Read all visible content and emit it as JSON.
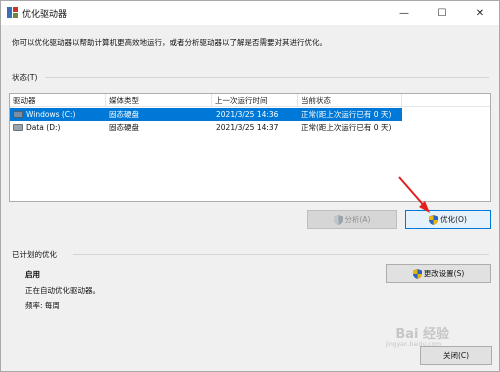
{
  "window": {
    "title": "优化驱动器",
    "controls": {
      "minimize": "—",
      "maximize": "☐",
      "close": "✕"
    }
  },
  "description": "你可以优化驱动器以帮助计算机更高效地运行，或者分析驱动器以了解是否需要对其进行优化。",
  "status": {
    "label": "状态(T)",
    "columns": [
      "驱动器",
      "媒体类型",
      "上一次运行时间",
      "当前状态"
    ],
    "rows": [
      {
        "drive": "Windows (C:)",
        "media": "固态硬盘",
        "last_run": "2021/3/25 14:36",
        "state": "正常(距上次运行已有 0 天)",
        "selected": true
      },
      {
        "drive": "Data (D:)",
        "media": "固态硬盘",
        "last_run": "2021/3/25 14:37",
        "state": "正常(距上次运行已有 0 天)",
        "selected": false
      }
    ]
  },
  "buttons": {
    "analyze": "分析(A)",
    "optimize": "优化(O)",
    "change_settings": "更改设置(S)",
    "close": "关闭(C)"
  },
  "scheduled": {
    "label": "已计划的优化",
    "state": "启用",
    "detail": "正在自动优化驱动器。",
    "frequency": "频率: 每周"
  },
  "watermark": {
    "main": "Bai 经验",
    "sub": "jingyan.baidu.com"
  },
  "colors": {
    "selection": "#0078d7",
    "arrow": "#e02020",
    "focus_border": "#0078d7"
  }
}
